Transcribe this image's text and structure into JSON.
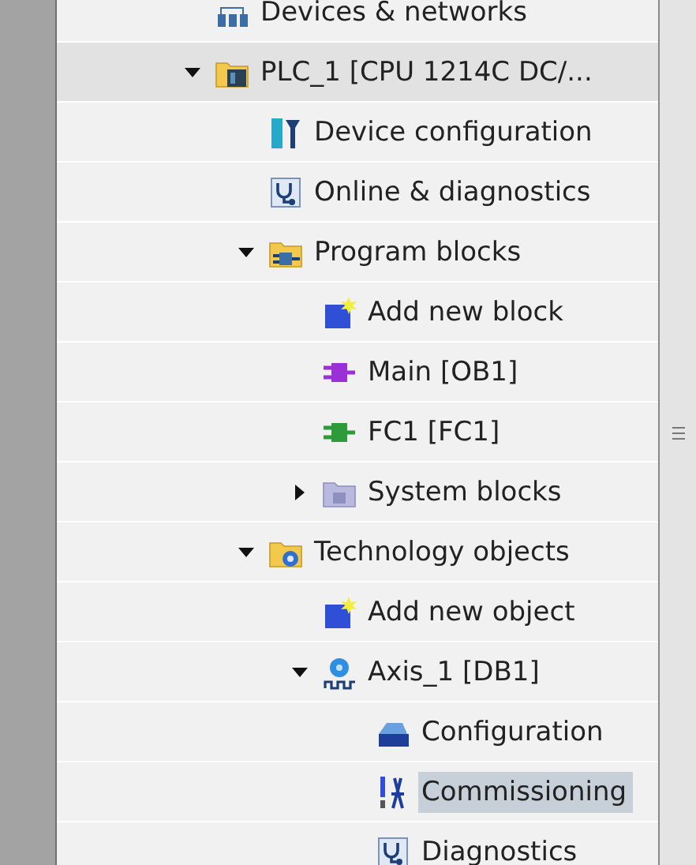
{
  "project_tree": {
    "items": [
      {
        "label": "Devices & networks",
        "kind": "network",
        "active": false,
        "selected": false
      },
      {
        "label": "PLC_1 [CPU 1214C DC/...",
        "kind": "station",
        "active": true,
        "selected": false,
        "expanded": true,
        "children": [
          {
            "label": "Device configuration",
            "kind": "device-config",
            "active": false,
            "selected": false
          },
          {
            "label": "Online & diagnostics",
            "kind": "diagnostics",
            "active": false,
            "selected": false
          },
          {
            "label": "Program blocks",
            "kind": "blocks-folder",
            "active": false,
            "selected": false,
            "expanded": true,
            "children": [
              {
                "label": "Add new block",
                "kind": "new-item",
                "active": false,
                "selected": false
              },
              {
                "label": "Main [OB1]",
                "kind": "block",
                "color": "#9b30d8",
                "active": false,
                "selected": false
              },
              {
                "label": "FC1 [FC1]",
                "kind": "block",
                "color": "#2f9a3a",
                "active": false,
                "selected": false
              },
              {
                "label": "System blocks",
                "kind": "system-folder",
                "active": false,
                "selected": false,
                "expanded": false
              }
            ]
          },
          {
            "label": "Technology objects",
            "kind": "tech-folder",
            "active": false,
            "selected": false,
            "expanded": true,
            "children": [
              {
                "label": "Add new object",
                "kind": "new-item",
                "active": false,
                "selected": false
              },
              {
                "label": "Axis_1 [DB1]",
                "kind": "axis",
                "active": false,
                "selected": false,
                "expanded": true,
                "children": [
                  {
                    "label": "Configuration",
                    "kind": "configuration",
                    "active": false,
                    "selected": false
                  },
                  {
                    "label": "Commissioning",
                    "kind": "commissioning",
                    "active": false,
                    "selected": true
                  },
                  {
                    "label": "Diagnostics",
                    "kind": "diagnostics",
                    "active": false,
                    "selected": false
                  }
                ]
              }
            ]
          }
        ]
      }
    ]
  }
}
